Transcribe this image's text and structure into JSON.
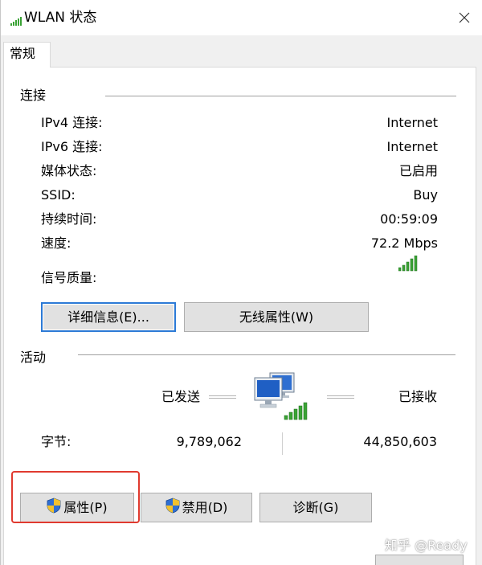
{
  "window": {
    "title": "WLAN 状态"
  },
  "tabs": [
    {
      "label": "常规"
    }
  ],
  "connection": {
    "title": "连接",
    "rows": [
      {
        "label": "IPv4 连接:",
        "value": "Internet"
      },
      {
        "label": "IPv6 连接:",
        "value": "Internet"
      },
      {
        "label": "媒体状态:",
        "value": "已启用"
      },
      {
        "label": "SSID:",
        "value": "Buy"
      },
      {
        "label": "持续时间:",
        "value": "00:59:09"
      },
      {
        "label": "速度:",
        "value": "72.2 Mbps"
      }
    ],
    "signal_label": "信号质量:",
    "signal_bars": 5,
    "details_button": "详细信息(E)...",
    "wireless_props_button": "无线属性(W)"
  },
  "activity": {
    "title": "活动",
    "sent_label": "已发送",
    "received_label": "已接收",
    "bytes_label": "字节:",
    "bytes_sent": "9,789,062",
    "bytes_received": "44,850,603"
  },
  "actions": {
    "properties_button": "属性(P)",
    "disable_button": "禁用(D)",
    "diagnose_button": "诊断(G)"
  },
  "watermark": "知乎 @Ready",
  "colors": {
    "signal_green": "#3aa335",
    "focus_blue": "#2c7ad6",
    "highlight_red": "#e03a2f"
  }
}
